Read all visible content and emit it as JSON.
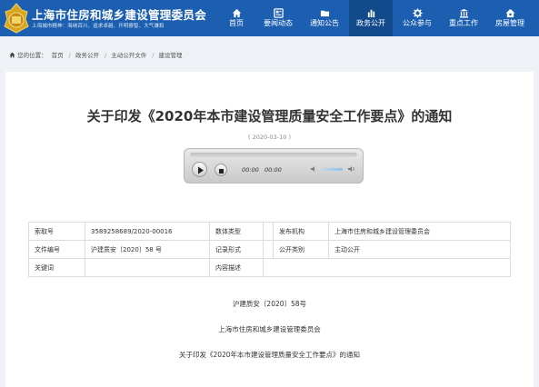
{
  "header": {
    "title": "上海市住房和城乡建设管理委员会",
    "slogan": "上海城市精神：海纳百川、追求卓越、开明睿智、大气谦和",
    "emblem_icon": "gold-emblem-icon",
    "colors": {
      "bar": "#1c5fb0",
      "active": "#134a8c"
    }
  },
  "nav": [
    {
      "label": "首页",
      "icon": "home-icon"
    },
    {
      "label": "要闻动态",
      "icon": "news-icon"
    },
    {
      "label": "通知公告",
      "icon": "folder-icon"
    },
    {
      "label": "政务公开",
      "icon": "chart-icon",
      "active": true
    },
    {
      "label": "公众参与",
      "icon": "gear-icon"
    },
    {
      "label": "重点工作",
      "icon": "building-icon"
    },
    {
      "label": "房屋管理",
      "icon": "house-icon"
    }
  ],
  "breadcrumb": {
    "prefix": "您的位置：",
    "items": [
      "首页",
      "政务公开",
      "主动公开文件",
      "建设管理"
    ]
  },
  "article": {
    "title": "关于印发《2020年本市建设管理质量安全工作要点》的通知",
    "date": "( 2020-03-10 )",
    "player": {
      "current_time": "00:00",
      "total_time": "00:00"
    },
    "meta": {
      "index_label": "索取号",
      "index_value": "3589258689/2020-00016",
      "data_type_label": "数体类型",
      "data_type_value": "",
      "publisher_label": "发布机构",
      "publisher_value": "上海市住房和城乡建设管理委员会",
      "doc_no_label": "文件编号",
      "doc_no_value": "沪建质安〔2020〕58 号",
      "record_label": "记录形式",
      "record_value": "",
      "category_label": "公开类别",
      "category_value": "主动公开",
      "keywords_label": "关键词",
      "keywords_value": "",
      "summary_label": "内容描述",
      "summary_value": ""
    },
    "body": [
      "沪建质安〔2020〕58号",
      "上海市住房和城乡建设管理委员会",
      "关于印发《2020年本市建设管理质量安全工作要点》的通知"
    ]
  }
}
